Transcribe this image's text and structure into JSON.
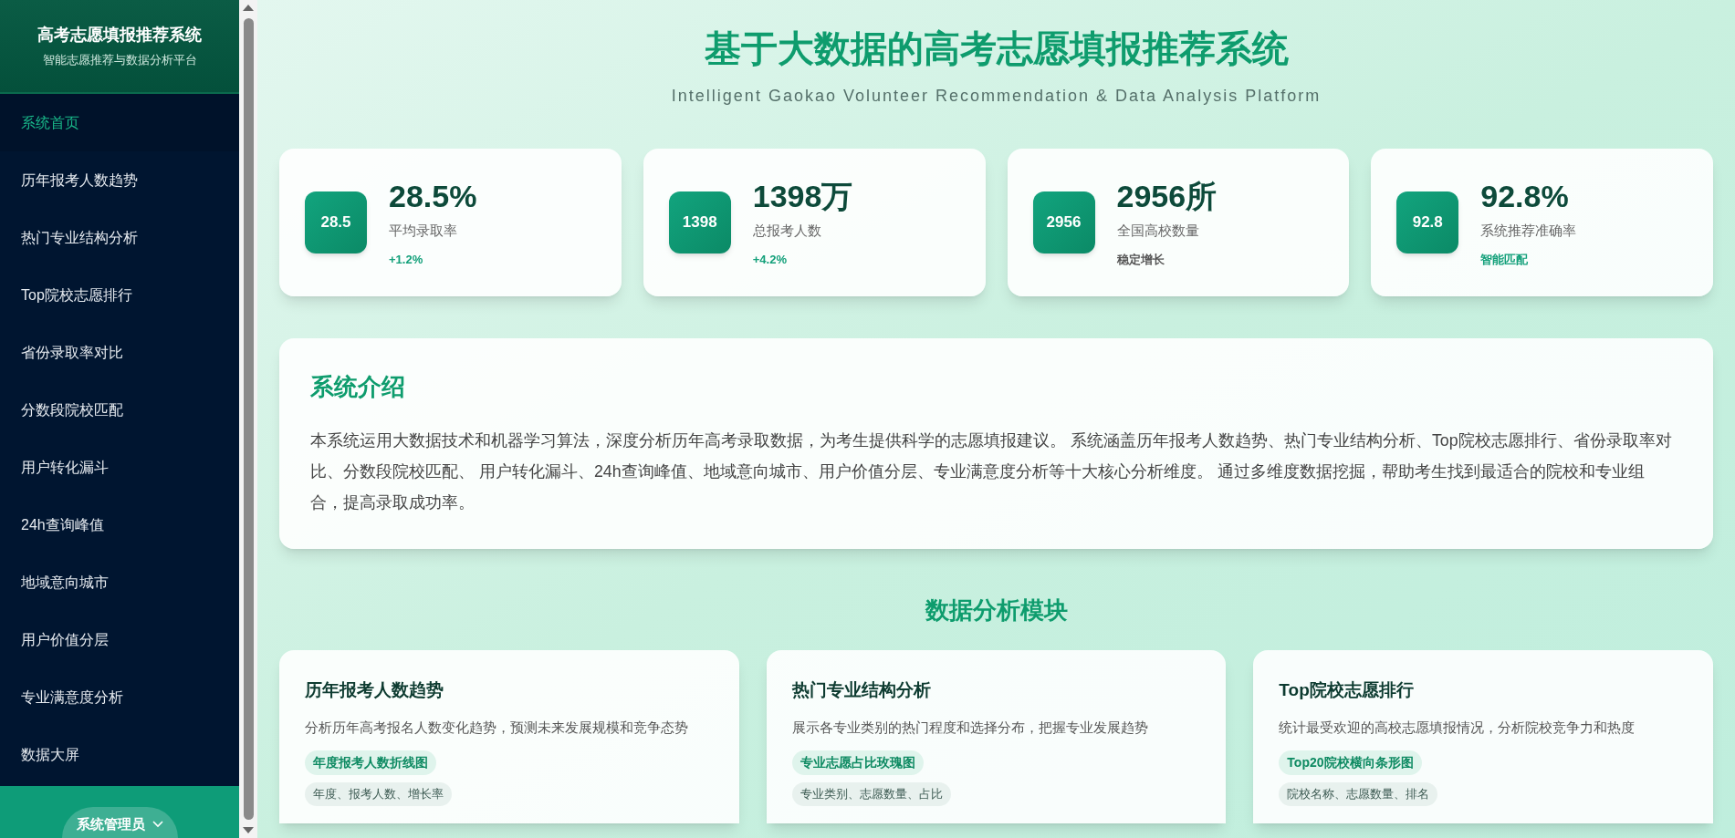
{
  "sidebar": {
    "title": "高考志愿填报推荐系统",
    "subtitle": "智能志愿推荐与数据分析平台",
    "items": [
      {
        "label": "系统首页",
        "selected": true
      },
      {
        "label": "历年报考人数趋势",
        "selected": false
      },
      {
        "label": "热门专业结构分析",
        "selected": false
      },
      {
        "label": "Top院校志愿排行",
        "selected": false
      },
      {
        "label": "省份录取率对比",
        "selected": false
      },
      {
        "label": "分数段院校匹配",
        "selected": false
      },
      {
        "label": "用户转化漏斗",
        "selected": false
      },
      {
        "label": "24h查询峰值",
        "selected": false
      },
      {
        "label": "地域意向城市",
        "selected": false
      },
      {
        "label": "用户价值分层",
        "selected": false
      },
      {
        "label": "专业满意度分析",
        "selected": false
      },
      {
        "label": "数据大屏",
        "selected": false
      }
    ],
    "user_menu": "系统管理员"
  },
  "header": {
    "title": "基于大数据的高考志愿填报推荐系统",
    "subtitle": "Intelligent Gaokao Volunteer Recommendation & Data Analysis Platform"
  },
  "stats": [
    {
      "badge": "28.5",
      "value": "28.5%",
      "label": "平均录取率",
      "note": "+1.2%",
      "kind": "accent"
    },
    {
      "badge": "1398",
      "value": "1398万",
      "label": "总报考人数",
      "note": "+4.2%",
      "kind": "accent"
    },
    {
      "badge": "2956",
      "value": "2956所",
      "label": "全国高校数量",
      "note": "稳定增长",
      "kind": "neutral"
    },
    {
      "badge": "92.8",
      "value": "92.8%",
      "label": "系统推荐准确率",
      "note": "智能匹配",
      "kind": "accent"
    }
  ],
  "intro": {
    "title": "系统介绍",
    "text": "本系统运用大数据技术和机器学习算法，深度分析历年高考录取数据，为考生提供科学的志愿填报建议。 系统涵盖历年报考人数趋势、热门专业结构分析、Top院校志愿排行、省份录取率对比、分数段院校匹配、 用户转化漏斗、24h查询峰值、地域意向城市、用户价值分层、专业满意度分析等十大核心分析维度。 通过多维度数据挖掘，帮助考生找到最适合的院校和专业组合，提高录取成功率。"
  },
  "modules": {
    "title": "数据分析模块",
    "cards": [
      {
        "title": "历年报考人数趋势",
        "description": "分析历年高考报名人数变化趋势，预测未来发展规模和竞争态势",
        "chart_tag": "年度报考人数折线图",
        "fields_tag": "年度、报考人数、增长率"
      },
      {
        "title": "热门专业结构分析",
        "description": "展示各专业类别的热门程度和选择分布，把握专业发展趋势",
        "chart_tag": "专业志愿占比玫瑰图",
        "fields_tag": "专业类别、志愿数量、占比"
      },
      {
        "title": "Top院校志愿排行",
        "description": "统计最受欢迎的高校志愿填报情况，分析院校竞争力和热度",
        "chart_tag": "Top20院校横向条形图",
        "fields_tag": "院校名称、志愿数量、排名"
      }
    ]
  }
}
